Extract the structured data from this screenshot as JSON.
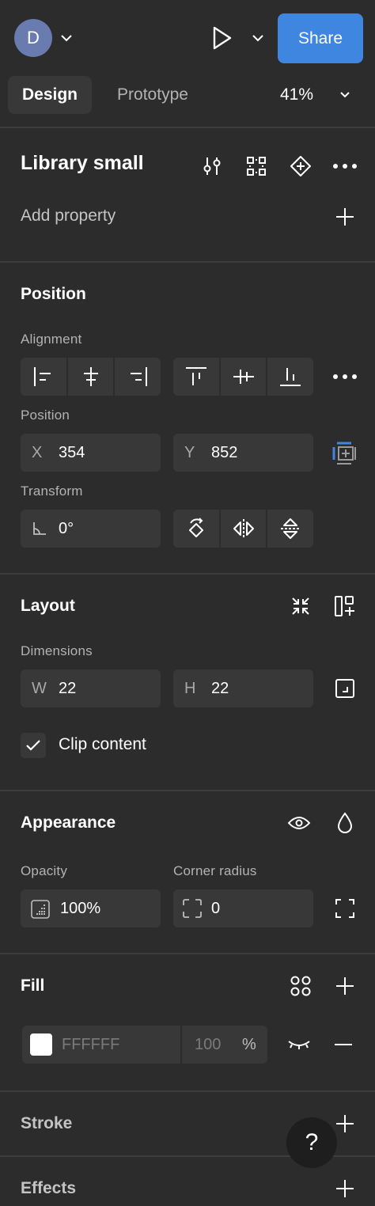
{
  "topbar": {
    "avatar_initial": "D",
    "share_label": "Share",
    "tabs": [
      {
        "label": "Design",
        "active": true
      },
      {
        "label": "Prototype",
        "active": false
      }
    ],
    "zoom": "41%"
  },
  "component": {
    "title": "Library small",
    "add_property_label": "Add property"
  },
  "position_section": {
    "title": "Position",
    "alignment_label": "Alignment",
    "position_label": "Position",
    "x_prefix": "X",
    "x_value": "354",
    "y_prefix": "Y",
    "y_value": "852",
    "transform_label": "Transform",
    "rotation_value": "0°"
  },
  "layout_section": {
    "title": "Layout",
    "dimensions_label": "Dimensions",
    "w_prefix": "W",
    "w_value": "22",
    "h_prefix": "H",
    "h_value": "22",
    "clip_label": "Clip content",
    "clip_checked": true
  },
  "appearance_section": {
    "title": "Appearance",
    "opacity_label": "Opacity",
    "opacity_value": "100%",
    "corner_label": "Corner radius",
    "corner_value": "0"
  },
  "fill_section": {
    "title": "Fill",
    "hex": "FFFFFF",
    "opacity": "100",
    "percent": "%",
    "swatch_color": "#FFFFFF"
  },
  "stroke_section": {
    "title": "Stroke"
  },
  "effects_section": {
    "title": "Effects"
  },
  "help": {
    "label": "?"
  },
  "colors": {
    "accent": "#3f86e0",
    "panel": "#2c2c2c",
    "field": "#383838"
  }
}
